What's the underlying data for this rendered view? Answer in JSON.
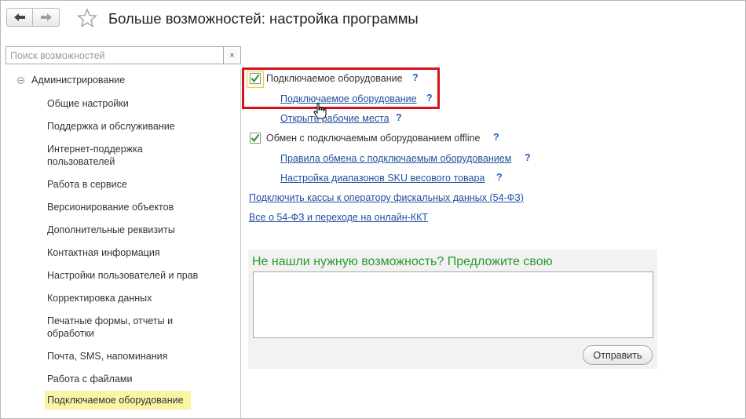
{
  "header": {
    "title": "Больше возможностей: настройка программы",
    "back_icon": "arrow-left-icon",
    "forward_icon": "arrow-right-icon",
    "favorite_icon": "star-icon"
  },
  "search": {
    "placeholder": "Поиск возможностей",
    "value": "",
    "clear_label": "×"
  },
  "sidebar": {
    "group_label": "Администрирование",
    "items": [
      {
        "label": "Общие настройки"
      },
      {
        "label": "Поддержка и обслуживание"
      },
      {
        "label": "Интернет-поддержка пользователей"
      },
      {
        "label": "Работа в сервисе"
      },
      {
        "label": "Версионирование объектов"
      },
      {
        "label": "Дополнительные реквизиты"
      },
      {
        "label": "Контактная информация"
      },
      {
        "label": "Настройки пользователей и прав"
      },
      {
        "label": "Корректировка данных"
      },
      {
        "label": "Печатные формы, отчеты и обработки"
      },
      {
        "label": "Почта, SMS, напоминания"
      },
      {
        "label": "Работа с файлами"
      },
      {
        "label": "Подключаемое оборудование"
      }
    ],
    "active_item": "Подключаемое оборудование"
  },
  "content": {
    "equipment_checkbox": {
      "label": "Подключаемое оборудование",
      "checked": true,
      "help": "?"
    },
    "equipment_link": {
      "label": "Подключаемое оборудование",
      "help": "?"
    },
    "workplaces_link": {
      "label": "Открыть рабочие места",
      "help": "?"
    },
    "offline_checkbox": {
      "label": "Обмен с подключаемым оборудованием offline",
      "checked": true,
      "help": "?"
    },
    "exchange_rules_link": {
      "label": "Правила обмена с подключаемым оборудованием",
      "help": "?"
    },
    "sku_ranges_link": {
      "label": "Настройка диапазонов SKU весового товара",
      "help": "?"
    },
    "fiscal_link": {
      "label": "Подключить кассы к оператору фискальных данных (54-ФЗ)"
    },
    "about_54fz_link": {
      "label": "Все о 54-ФЗ и переходе на онлайн-ККТ"
    }
  },
  "suggest": {
    "title": "Не нашли нужную возможность? Предложите свою",
    "textarea_value": "",
    "send_label": "Отправить"
  },
  "colors": {
    "link": "#1f4e9f",
    "highlight_border": "#d4121a",
    "active_item_bg": "#fbf3a6",
    "suggest_title": "#2a9a2c",
    "checkmark": "#3a9a2e"
  }
}
